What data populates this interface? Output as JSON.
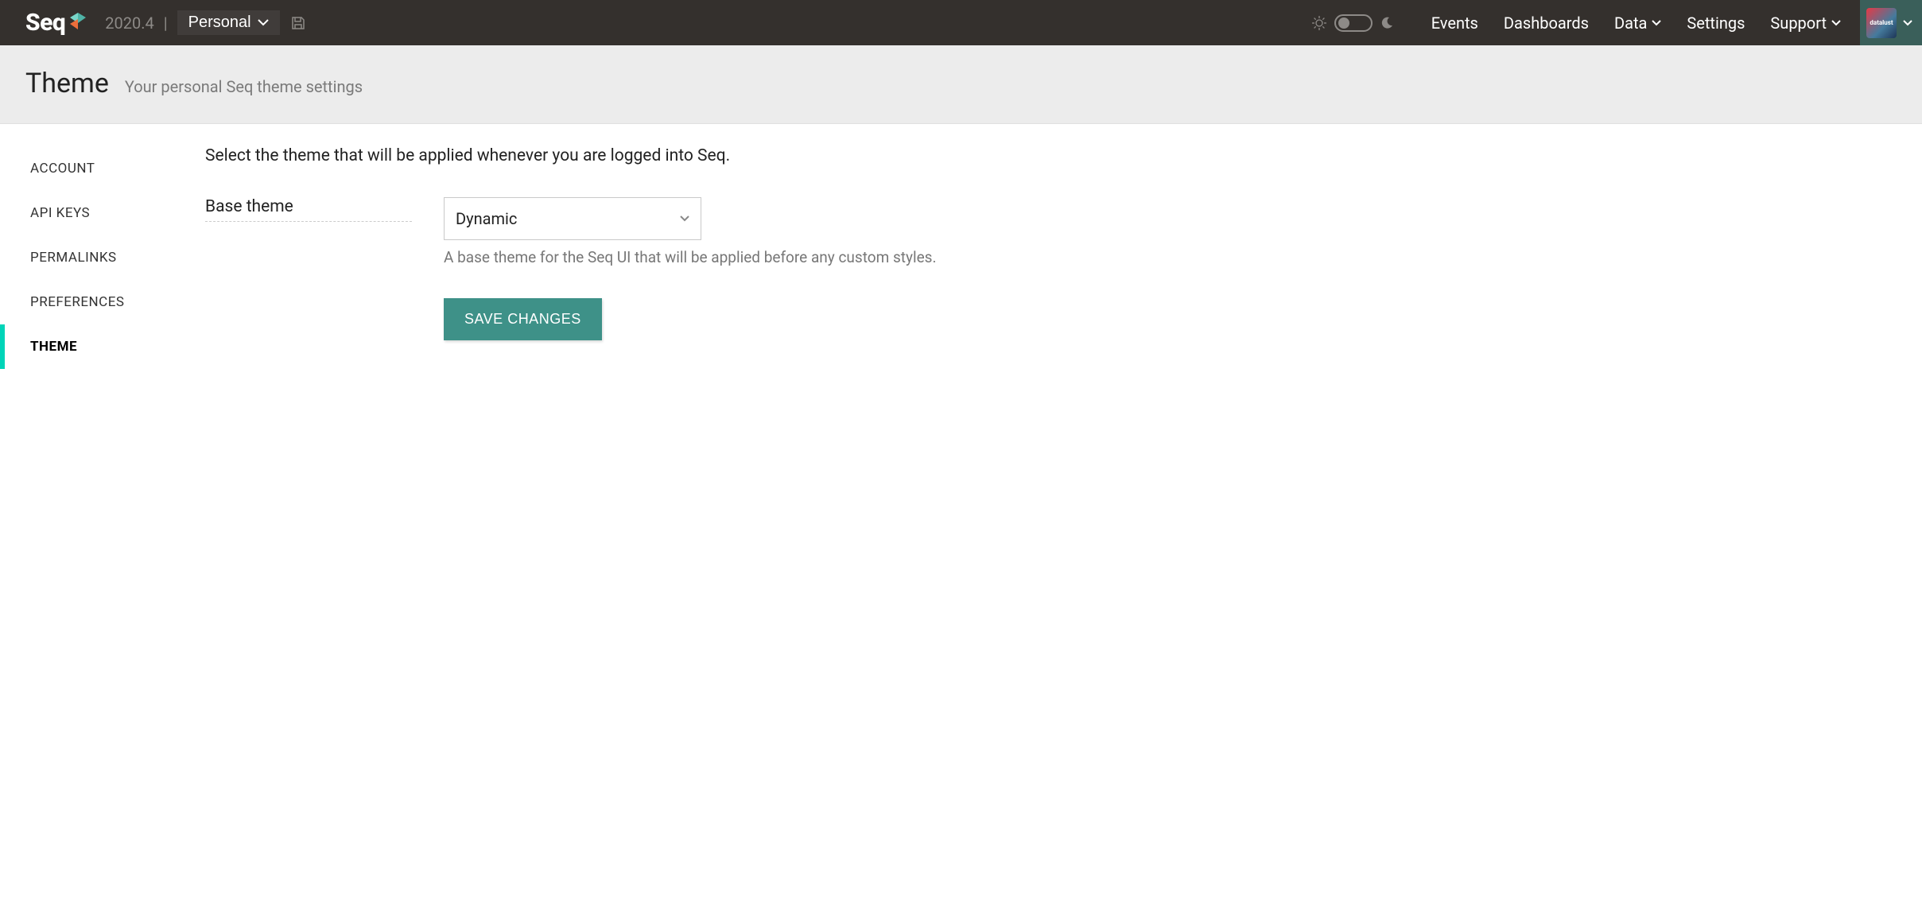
{
  "topbar": {
    "brand": "Seq",
    "version": "2020.4",
    "workspace": "Personal",
    "nav": {
      "events": "Events",
      "dashboards": "Dashboards",
      "data": "Data",
      "settings": "Settings",
      "support": "Support"
    },
    "user_avatar_text": "datalust"
  },
  "pagehead": {
    "title": "Theme",
    "subtitle": "Your personal Seq theme settings"
  },
  "sidebar": {
    "items": [
      {
        "label": "ACCOUNT",
        "active": false
      },
      {
        "label": "API KEYS",
        "active": false
      },
      {
        "label": "PERMALINKS",
        "active": false
      },
      {
        "label": "PREFERENCES",
        "active": false
      },
      {
        "label": "THEME",
        "active": true
      }
    ]
  },
  "content": {
    "intro": "Select the theme that will be applied whenever you are logged into Seq.",
    "base_theme_label": "Base theme",
    "base_theme_value": "Dynamic",
    "base_theme_help": "A base theme for the Seq UI that will be applied before any custom styles.",
    "save_button": "SAVE CHANGES"
  }
}
